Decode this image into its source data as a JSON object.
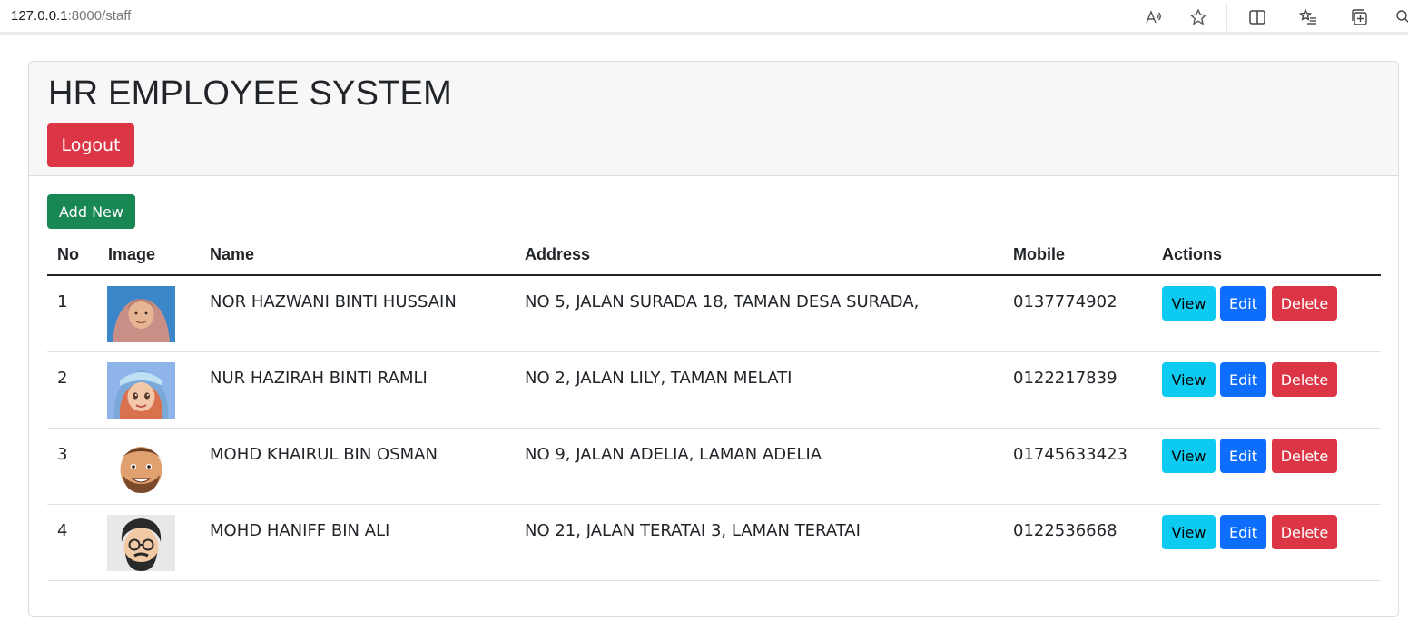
{
  "browser": {
    "url_host": "127.0.0.1",
    "url_rest": ":8000/staff"
  },
  "header": {
    "title": "HR EMPLOYEE SYSTEM",
    "logout_label": "Logout"
  },
  "toolbar": {
    "add_label": "Add New"
  },
  "table": {
    "headers": {
      "no": "No",
      "image": "Image",
      "name": "Name",
      "address": "Address",
      "mobile": "Mobile",
      "actions": "Actions"
    },
    "actions": {
      "view": "View",
      "edit": "Edit",
      "delete": "Delete"
    },
    "rows": [
      {
        "no": "1",
        "name": "NOR HAZWANI BINTI HUSSAIN",
        "address": "NO 5, JALAN SURADA 18, TAMAN DESA SURADA,",
        "mobile": "0137774902",
        "image": "woman-hijab-photo"
      },
      {
        "no": "2",
        "name": "NUR HAZIRAH BINTI RAMLI",
        "address": "NO 2, JALAN LILY, TAMAN MELATI",
        "mobile": "0122217839",
        "image": "cartoon-girl-avatar"
      },
      {
        "no": "3",
        "name": "MOHD KHAIRUL BIN OSMAN",
        "address": "NO 9, JALAN ADELIA, LAMAN ADELIA",
        "mobile": "01745633423",
        "image": "bearded-man-emoji"
      },
      {
        "no": "4",
        "name": "MOHD HANIFF BIN ALI",
        "address": "NO 21, JALAN TERATAI 3, LAMAN TERATAI",
        "mobile": "0122536668",
        "image": "glasses-man-avatar"
      }
    ]
  },
  "colors": {
    "danger": "#dc3545",
    "success": "#198754",
    "info": "#0dcaf0",
    "primary": "#0d6efd"
  }
}
